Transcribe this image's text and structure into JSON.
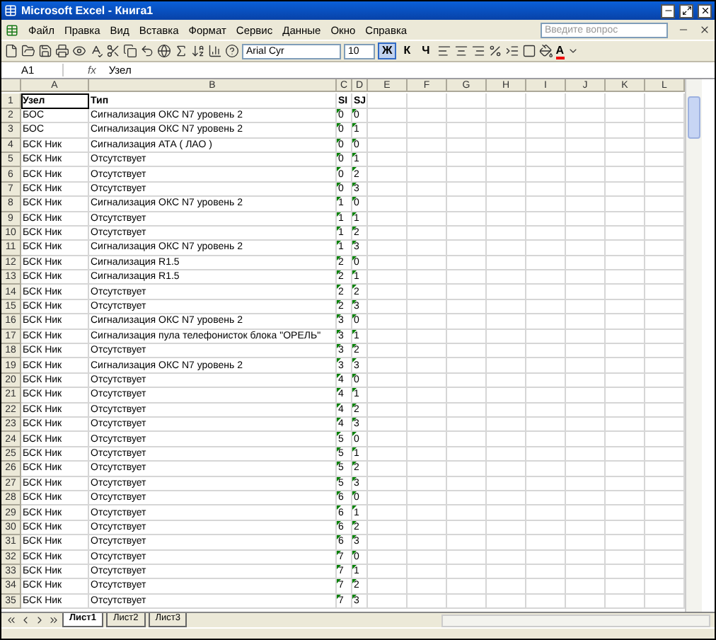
{
  "window": {
    "title": "Microsoft Excel - Книга1"
  },
  "menu": [
    "Файл",
    "Правка",
    "Вид",
    "Вставка",
    "Формат",
    "Сервис",
    "Данные",
    "Окно",
    "Справка"
  ],
  "help_box": {
    "placeholder": "Введите вопрос"
  },
  "toolbar": {
    "font": "Arial Cyr",
    "size": "10",
    "format_buttons": [
      {
        "label": "Ж",
        "selected": true
      },
      {
        "label": "К",
        "selected": false
      },
      {
        "label": "Ч",
        "selected": false
      }
    ],
    "font_color_label": "A"
  },
  "formula_bar": {
    "name_box": "A1",
    "fx": "fx",
    "value": "Узел"
  },
  "columns": [
    "A",
    "B",
    "C",
    "D",
    "E",
    "F",
    "G",
    "H",
    "I",
    "J",
    "K",
    "L"
  ],
  "rows": [
    {
      "num": "1",
      "a": "Узел",
      "b": "Тип",
      "c": "SI",
      "d": "SJ",
      "header": true,
      "flagged": false
    },
    {
      "num": "2",
      "a": "БОС",
      "b": "Сигнализация ОКС N7 уровень 2",
      "c": "0",
      "d": "0",
      "header": false,
      "flagged": true
    },
    {
      "num": "3",
      "a": "БОС",
      "b": "Сигнализация ОКС N7 уровень 2",
      "c": "0",
      "d": "1",
      "header": false,
      "flagged": true
    },
    {
      "num": "4",
      "a": "БСК Ник",
      "b": "Сигнализация АТА ( ЛАО )",
      "c": "0",
      "d": "0",
      "header": false,
      "flagged": true
    },
    {
      "num": "5",
      "a": "БСК Ник",
      "b": "Отсутствует",
      "c": "0",
      "d": "1",
      "header": false,
      "flagged": true
    },
    {
      "num": "6",
      "a": "БСК Ник",
      "b": "Отсутствует",
      "c": "0",
      "d": "2",
      "header": false,
      "flagged": true
    },
    {
      "num": "7",
      "a": "БСК Ник",
      "b": "Отсутствует",
      "c": "0",
      "d": "3",
      "header": false,
      "flagged": true
    },
    {
      "num": "8",
      "a": "БСК Ник",
      "b": "Сигнализация ОКС N7 уровень 2",
      "c": "1",
      "d": "0",
      "header": false,
      "flagged": true
    },
    {
      "num": "9",
      "a": "БСК Ник",
      "b": "Отсутствует",
      "c": "1",
      "d": "1",
      "header": false,
      "flagged": true
    },
    {
      "num": "10",
      "a": "БСК Ник",
      "b": "Отсутствует",
      "c": "1",
      "d": "2",
      "header": false,
      "flagged": true
    },
    {
      "num": "11",
      "a": "БСК Ник",
      "b": "Сигнализация ОКС N7 уровень 2",
      "c": "1",
      "d": "3",
      "header": false,
      "flagged": true
    },
    {
      "num": "12",
      "a": "БСК Ник",
      "b": "Сигнализация R1.5",
      "c": "2",
      "d": "0",
      "header": false,
      "flagged": true
    },
    {
      "num": "13",
      "a": "БСК Ник",
      "b": "Сигнализация R1.5",
      "c": "2",
      "d": "1",
      "header": false,
      "flagged": true
    },
    {
      "num": "14",
      "a": "БСК Ник",
      "b": "Отсутствует",
      "c": "2",
      "d": "2",
      "header": false,
      "flagged": true
    },
    {
      "num": "15",
      "a": "БСК Ник",
      "b": "Отсутствует",
      "c": "2",
      "d": "3",
      "header": false,
      "flagged": true
    },
    {
      "num": "16",
      "a": "БСК Ник",
      "b": "Сигнализация ОКС N7 уровень 2",
      "c": "3",
      "d": "0",
      "header": false,
      "flagged": true
    },
    {
      "num": "17",
      "a": "БСК Ник",
      "b": "Сигнализация пула телефонисток блока \"ОРЕЛЬ\"",
      "c": "3",
      "d": "1",
      "header": false,
      "flagged": true
    },
    {
      "num": "18",
      "a": "БСК Ник",
      "b": "Отсутствует",
      "c": "3",
      "d": "2",
      "header": false,
      "flagged": true
    },
    {
      "num": "19",
      "a": "БСК Ник",
      "b": "Сигнализация ОКС N7 уровень 2",
      "c": "3",
      "d": "3",
      "header": false,
      "flagged": true
    },
    {
      "num": "20",
      "a": "БСК Ник",
      "b": "Отсутствует",
      "c": "4",
      "d": "0",
      "header": false,
      "flagged": true
    },
    {
      "num": "21",
      "a": "БСК Ник",
      "b": "Отсутствует",
      "c": "4",
      "d": "1",
      "header": false,
      "flagged": true
    },
    {
      "num": "22",
      "a": "БСК Ник",
      "b": "Отсутствует",
      "c": "4",
      "d": "2",
      "header": false,
      "flagged": true
    },
    {
      "num": "23",
      "a": "БСК Ник",
      "b": "Отсутствует",
      "c": "4",
      "d": "3",
      "header": false,
      "flagged": true
    },
    {
      "num": "24",
      "a": "БСК Ник",
      "b": "Отсутствует",
      "c": "5",
      "d": "0",
      "header": false,
      "flagged": true
    },
    {
      "num": "25",
      "a": "БСК Ник",
      "b": "Отсутствует",
      "c": "5",
      "d": "1",
      "header": false,
      "flagged": true
    },
    {
      "num": "26",
      "a": "БСК Ник",
      "b": "Отсутствует",
      "c": "5",
      "d": "2",
      "header": false,
      "flagged": true
    },
    {
      "num": "27",
      "a": "БСК Ник",
      "b": "Отсутствует",
      "c": "5",
      "d": "3",
      "header": false,
      "flagged": true
    },
    {
      "num": "28",
      "a": "БСК Ник",
      "b": "Отсутствует",
      "c": "6",
      "d": "0",
      "header": false,
      "flagged": true
    },
    {
      "num": "29",
      "a": "БСК Ник",
      "b": "Отсутствует",
      "c": "6",
      "d": "1",
      "header": false,
      "flagged": true
    },
    {
      "num": "30",
      "a": "БСК Ник",
      "b": "Отсутствует",
      "c": "6",
      "d": "2",
      "header": false,
      "flagged": true
    },
    {
      "num": "31",
      "a": "БСК Ник",
      "b": "Отсутствует",
      "c": "6",
      "d": "3",
      "header": false,
      "flagged": true
    },
    {
      "num": "32",
      "a": "БСК Ник",
      "b": "Отсутствует",
      "c": "7",
      "d": "0",
      "header": false,
      "flagged": true
    },
    {
      "num": "33",
      "a": "БСК Ник",
      "b": "Отсутствует",
      "c": "7",
      "d": "1",
      "header": false,
      "flagged": true
    },
    {
      "num": "34",
      "a": "БСК Ник",
      "b": "Отсутствует",
      "c": "7",
      "d": "2",
      "header": false,
      "flagged": true
    },
    {
      "num": "35",
      "a": "БСК Ник",
      "b": "Отсутствует",
      "c": "7",
      "d": "3",
      "header": false,
      "flagged": true
    }
  ],
  "sheet_tabs": [
    {
      "label": "Лист1",
      "selected": true
    },
    {
      "label": "Лист2",
      "selected": false
    },
    {
      "label": "Лист3",
      "selected": false
    }
  ]
}
